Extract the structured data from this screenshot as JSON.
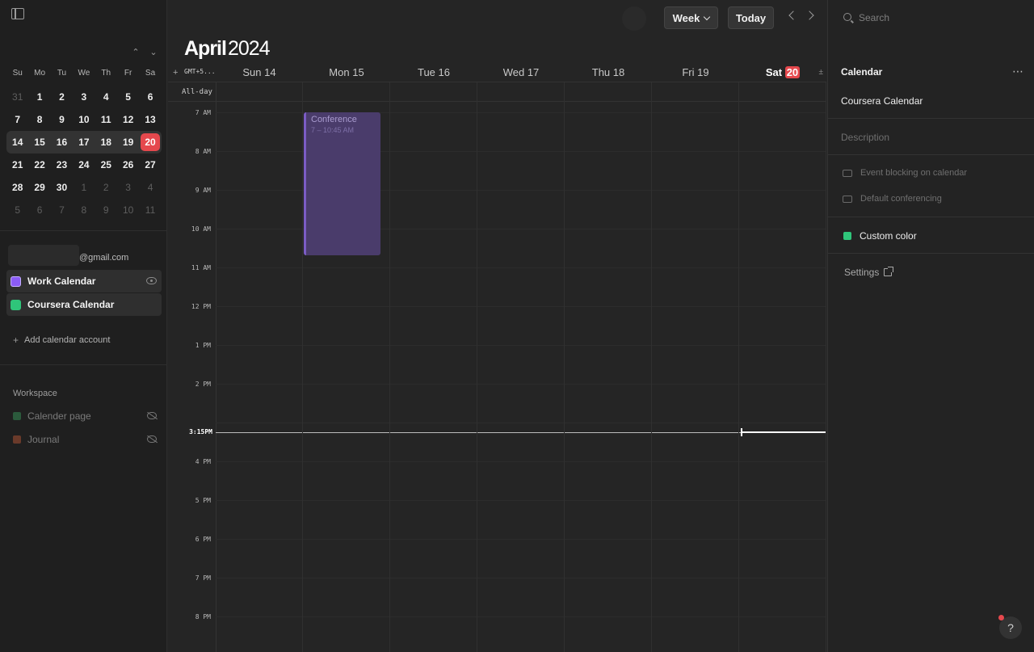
{
  "sidebar": {
    "weekdays": [
      "Su",
      "Mo",
      "Tu",
      "We",
      "Th",
      "Fr",
      "Sa"
    ],
    "weeks": [
      [
        {
          "d": "31",
          "dim": true
        },
        {
          "d": "1"
        },
        {
          "d": "2"
        },
        {
          "d": "3"
        },
        {
          "d": "4"
        },
        {
          "d": "5"
        },
        {
          "d": "6"
        }
      ],
      [
        {
          "d": "7"
        },
        {
          "d": "8"
        },
        {
          "d": "9"
        },
        {
          "d": "10"
        },
        {
          "d": "11"
        },
        {
          "d": "12"
        },
        {
          "d": "13"
        }
      ],
      [
        {
          "d": "14"
        },
        {
          "d": "15"
        },
        {
          "d": "16"
        },
        {
          "d": "17"
        },
        {
          "d": "18"
        },
        {
          "d": "19"
        },
        {
          "d": "20",
          "today": true
        }
      ],
      [
        {
          "d": "21"
        },
        {
          "d": "22"
        },
        {
          "d": "23"
        },
        {
          "d": "24"
        },
        {
          "d": "25"
        },
        {
          "d": "26"
        },
        {
          "d": "27"
        }
      ],
      [
        {
          "d": "28"
        },
        {
          "d": "29"
        },
        {
          "d": "30"
        },
        {
          "d": "1",
          "dim": true
        },
        {
          "d": "2",
          "dim": true
        },
        {
          "d": "3",
          "dim": true
        },
        {
          "d": "4",
          "dim": true
        }
      ],
      [
        {
          "d": "5",
          "dim": true
        },
        {
          "d": "6",
          "dim": true
        },
        {
          "d": "7",
          "dim": true
        },
        {
          "d": "8",
          "dim": true
        },
        {
          "d": "9",
          "dim": true
        },
        {
          "d": "10",
          "dim": true
        },
        {
          "d": "11",
          "dim": true
        }
      ]
    ],
    "selected_week_index": 2,
    "account_email_suffix": "@gmail.com",
    "calendars": [
      {
        "label": "Work Calendar",
        "color": "#8b5cf6",
        "icon": "square"
      },
      {
        "label": "Coursera Calendar",
        "color": "#2fc57a",
        "icon": "rss"
      }
    ],
    "add_account_label": "Add calendar account",
    "workspace_title": "Workspace",
    "workspace_items": [
      {
        "label": "Calender page",
        "color": "#2b5a3c"
      },
      {
        "label": "Journal",
        "color": "#6a3a2a"
      }
    ]
  },
  "topbar": {
    "view_label": "Week",
    "today_label": "Today"
  },
  "header": {
    "month": "April",
    "year": "2024"
  },
  "grid": {
    "timezone_label": "GMT+5...",
    "allday_label": "All-day",
    "days": [
      {
        "name": "Sun",
        "num": "14"
      },
      {
        "name": "Mon",
        "num": "15"
      },
      {
        "name": "Tue",
        "num": "16"
      },
      {
        "name": "Wed",
        "num": "17"
      },
      {
        "name": "Thu",
        "num": "18"
      },
      {
        "name": "Fri",
        "num": "19"
      },
      {
        "name": "Sat",
        "num": "20",
        "today": true
      }
    ],
    "hours": [
      "7 AM",
      "8 AM",
      "9 AM",
      "10 AM",
      "11 AM",
      "12 PM",
      "1 PM",
      "2 PM",
      "3 PM",
      "4 PM",
      "5 PM",
      "6 PM",
      "7 PM",
      "8 PM"
    ],
    "now_label": "3:15PM",
    "event": {
      "title": "Conference",
      "time": "7 – 10:45 AM"
    }
  },
  "right_panel": {
    "search_placeholder": "Search",
    "title": "Calendar",
    "calendar_name": "Coursera Calendar",
    "description_placeholder": "Description",
    "options": [
      "Event blocking on calendar",
      "Default conferencing"
    ],
    "custom_color_label": "Custom color",
    "settings_label": "Settings",
    "help_label": "?"
  }
}
